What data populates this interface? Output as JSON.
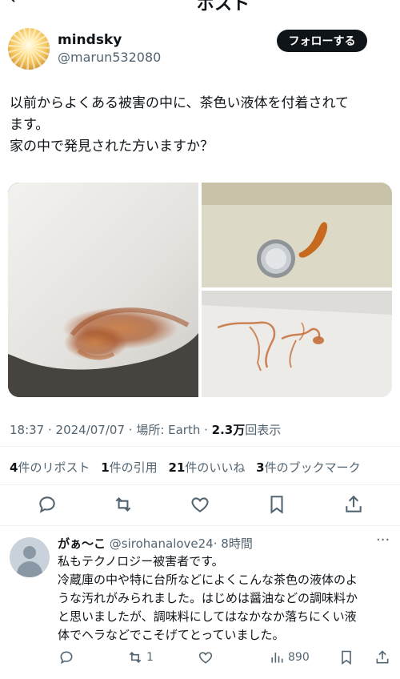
{
  "header": {
    "title": "ポスト"
  },
  "author": {
    "display_name": "mindsky",
    "handle": "@marun532080",
    "follow_label": "フォローする"
  },
  "tweet": {
    "text_lines": [
      "以前からよくある被害の中に、茶色い液体を付着されて",
      "ます。",
      "家の中で発見された方いますか？"
    ],
    "time": "18:37 · 2024/07/07",
    "location_label": "場所: Earth",
    "views_count": "2.3万",
    "views_label": "回表示"
  },
  "stats": {
    "reposts_count": "4",
    "reposts_label": "件のリポスト",
    "quotes_count": "1",
    "quotes_label": "件の引用",
    "likes_count": "21",
    "likes_label": "件のいいね",
    "bookmarks_count": "3",
    "bookmarks_label": "件のブックマーク"
  },
  "reply": {
    "name": "がぁ〜こ",
    "handle": "@sirohanalove24",
    "time": "· 8時間",
    "text_lines": [
      "私もテクノロジー被害者です。",
      "冷蔵庫の中や特に台所などによくこんな茶色の液体のよ",
      "うな汚れがみられました。はじめは醤油などの調味料か",
      "と思いましたが、調味料にしてはなかなか落ちにくい液",
      "体でヘラなどでこそげてとっていました。"
    ],
    "retweets": "1",
    "views": "890"
  },
  "colors": {
    "text": "#0f1419",
    "secondary": "#536471",
    "divider": "#eff3f4",
    "stain": "#b8662a"
  }
}
